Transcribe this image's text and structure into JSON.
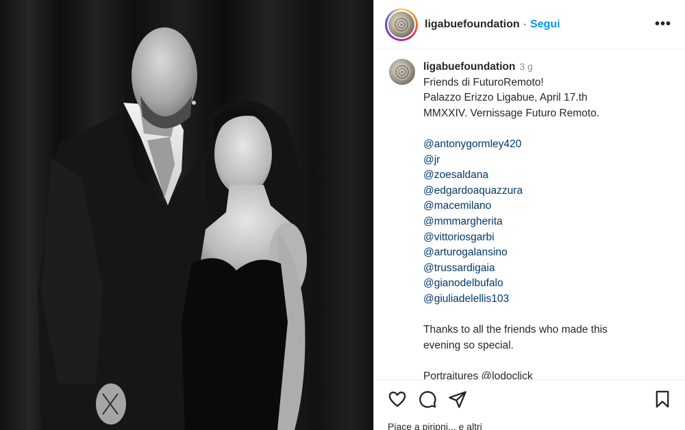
{
  "header": {
    "username": "ligabuefoundation",
    "separator": "·",
    "follow_label": "Segui",
    "more_label": "•••"
  },
  "caption": {
    "username": "ligabuefoundation",
    "time": "3 g",
    "lines": [
      "Friends di FuturoRemoto!",
      "Palazzo Erizzo Ligabue, April 17.th",
      "MMXXIV. Vernissage Futuro Remoto."
    ],
    "mentions": [
      "@antonygormley420",
      "@jr",
      "@zoesaldana",
      "@edgardoaquazzura",
      "@macemilano",
      "@mmmargherita",
      "@vittoriosgarbi",
      "@arturogalansino",
      "@trussardigaia",
      "@gianodelbufalo",
      "@giuliadelellis103"
    ],
    "thanks_lines": [
      "Thanks to all the friends who made this",
      "evening so special."
    ],
    "portraitures": "Portraitures @lodoclick"
  },
  "actions": {
    "icons": [
      "heart-icon",
      "comment-icon",
      "share-icon",
      "bookmark-icon"
    ],
    "likes_text": "Piace a piripni... e altri"
  },
  "colors": {
    "link": "#0095f6",
    "mention": "#00376b",
    "text": "#262626",
    "muted": "#8e8e8e"
  }
}
